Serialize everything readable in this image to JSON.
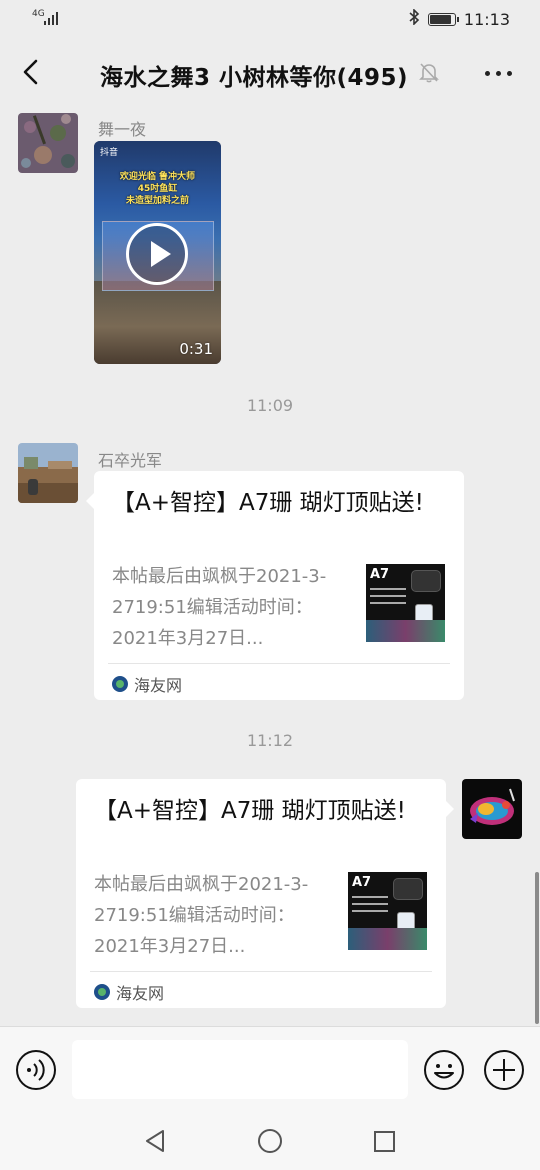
{
  "status_bar": {
    "network": "4G",
    "time": "11:13",
    "icons": [
      "signal-icon",
      "bluetooth-icon",
      "battery-icon"
    ]
  },
  "header": {
    "title": "海水之舞3 小树林等你(495)",
    "icons": [
      "back-icon",
      "mute-icon",
      "more-icon"
    ]
  },
  "messages": [
    {
      "type": "video",
      "sender": "舞一夜",
      "video": {
        "app_label": "抖音",
        "caption_lines": [
          "欢迎光临 鲁冲大师",
          "45吋鱼缸",
          "未造型加料之前"
        ],
        "duration": "0:31"
      }
    },
    {
      "type": "timestamp",
      "text": "11:09"
    },
    {
      "type": "link",
      "sender": "石卒光军",
      "link": {
        "title": "【A+智控】A7珊 瑚灯顶贴送!",
        "description": "本帖最后由飒枫于2021-3-2719:51编辑活动时间：2021年3月27日...",
        "source": "海友网",
        "thumb_label": "A7"
      }
    },
    {
      "type": "timestamp",
      "text": "11:12"
    },
    {
      "type": "link",
      "sender": "",
      "self": true,
      "link": {
        "title": "【A+智控】A7珊 瑚灯顶贴送!",
        "description": "本帖最后由飒枫于2021-3-2719:51编辑活动时间：2021年3月27日...",
        "source": "海友网",
        "thumb_label": "A7"
      }
    }
  ],
  "input_bar": {
    "value": "",
    "icons": [
      "voice-icon",
      "emoji-icon",
      "add-icon"
    ]
  },
  "nav_bar": {
    "icons": [
      "nav-back-icon",
      "nav-home-icon",
      "nav-recent-icon"
    ]
  },
  "colors": {
    "chat_bg": "#ededed",
    "card_bg": "#ffffff",
    "muted_text": "#888888"
  }
}
